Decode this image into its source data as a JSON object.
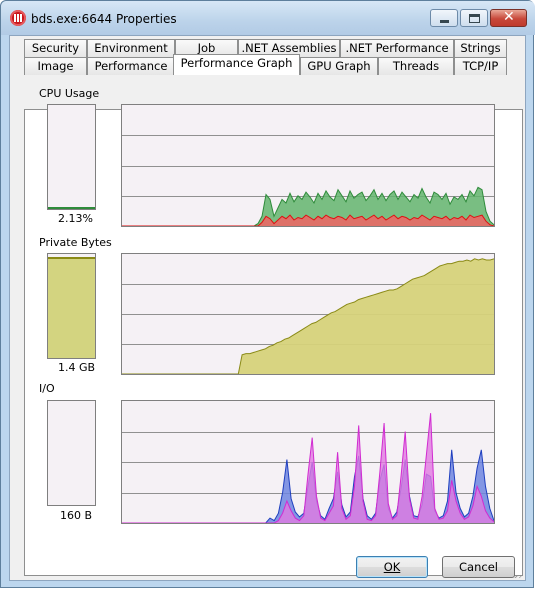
{
  "window": {
    "title": "bds.exe:6644 Properties",
    "icon": "process-app-icon"
  },
  "tabs_top": [
    "Security",
    "Environment",
    "Job",
    ".NET Assemblies",
    ".NET Performance",
    "Strings"
  ],
  "tabs_bottom": [
    "Image",
    "Performance",
    "Performance Graph",
    "GPU Graph",
    "Threads",
    "TCP/IP"
  ],
  "active_tab": "Performance Graph",
  "sections": {
    "cpu": {
      "label": "CPU Usage",
      "value": "2.13%",
      "fill_fraction": 0.02,
      "color": "#2e8b3a"
    },
    "private": {
      "label": "Private Bytes",
      "value": "1.4 GB",
      "fill_fraction": 0.95,
      "color": "#d3d480"
    },
    "io": {
      "label": "I/O",
      "value": "160 B",
      "fill_fraction": 0.0
    }
  },
  "graph_data": {
    "cpu_total": [
      0,
      0,
      0,
      0,
      0,
      0,
      0,
      0,
      0,
      0,
      0,
      0,
      0,
      0,
      0,
      0,
      0,
      0,
      0,
      0,
      0,
      0,
      0,
      0,
      0,
      0,
      0,
      0,
      0,
      0,
      0,
      0,
      0,
      0,
      2,
      8,
      26,
      22,
      8,
      15,
      22,
      19,
      27,
      20,
      25,
      22,
      28,
      24,
      19,
      27,
      22,
      29,
      24,
      21,
      30,
      25,
      20,
      29,
      23,
      26,
      28,
      21,
      25,
      30,
      22,
      27,
      21,
      26,
      29,
      22,
      28,
      24,
      20,
      26,
      23,
      31,
      24,
      19,
      28,
      26,
      22,
      27,
      18,
      24,
      22,
      26,
      20,
      29,
      25,
      32,
      30,
      12,
      4,
      1
    ],
    "cpu_kernel": [
      0,
      0,
      0,
      0,
      0,
      0,
      0,
      0,
      0,
      0,
      0,
      0,
      0,
      0,
      0,
      0,
      0,
      0,
      0,
      0,
      0,
      0,
      0,
      0,
      0,
      0,
      0,
      0,
      0,
      0,
      0,
      0,
      0,
      0,
      0,
      3,
      8,
      6,
      2,
      5,
      8,
      6,
      9,
      5,
      7,
      6,
      9,
      7,
      5,
      8,
      6,
      9,
      7,
      6,
      8,
      7,
      5,
      9,
      6,
      7,
      8,
      5,
      7,
      9,
      6,
      8,
      5,
      7,
      9,
      6,
      8,
      7,
      5,
      7,
      6,
      9,
      7,
      5,
      8,
      7,
      6,
      8,
      5,
      7,
      6,
      8,
      5,
      9,
      7,
      8,
      9,
      4,
      1,
      0
    ],
    "private_bytes": [
      0,
      0,
      0,
      0,
      0,
      0,
      0,
      0,
      0,
      0,
      0,
      0,
      0,
      0,
      0,
      0,
      0,
      0,
      0,
      0,
      0,
      0,
      0,
      0,
      0,
      0,
      0,
      0,
      0,
      0,
      0,
      16,
      17,
      17,
      18,
      19,
      20,
      21,
      23,
      24,
      26,
      27,
      29,
      30,
      32,
      34,
      36,
      38,
      40,
      42,
      43,
      45,
      47,
      49,
      51,
      52,
      54,
      56,
      58,
      59,
      60,
      62,
      63,
      64,
      65,
      66,
      67,
      68,
      69,
      70,
      70,
      71,
      73,
      75,
      77,
      79,
      80,
      81,
      82,
      84,
      86,
      88,
      90,
      91,
      92,
      92,
      93,
      94,
      94,
      95,
      94,
      96,
      95,
      96,
      95,
      95,
      96
    ],
    "io_read": [
      0,
      0,
      0,
      0,
      0,
      0,
      0,
      0,
      0,
      0,
      0,
      0,
      0,
      0,
      0,
      0,
      0,
      0,
      0,
      0,
      0,
      0,
      0,
      0,
      0,
      0,
      0,
      0,
      0,
      0,
      0,
      0,
      0,
      0,
      0,
      4,
      2,
      8,
      25,
      52,
      20,
      9,
      5,
      8,
      30,
      50,
      18,
      6,
      3,
      12,
      20,
      42,
      15,
      5,
      9,
      38,
      55,
      20,
      6,
      3,
      8,
      35,
      48,
      12,
      4,
      9,
      28,
      52,
      22,
      6,
      5,
      15,
      40,
      38,
      10,
      4,
      6,
      18,
      60,
      25,
      12,
      5,
      8,
      22,
      45,
      60,
      30,
      12,
      2
    ],
    "io_write": [
      0,
      0,
      0,
      0,
      0,
      0,
      0,
      0,
      0,
      0,
      0,
      0,
      0,
      0,
      0,
      0,
      0,
      0,
      0,
      0,
      0,
      0,
      0,
      0,
      0,
      0,
      0,
      0,
      0,
      0,
      0,
      0,
      0,
      0,
      0,
      0,
      0,
      2,
      8,
      18,
      10,
      4,
      2,
      6,
      40,
      70,
      22,
      4,
      2,
      8,
      14,
      58,
      12,
      3,
      6,
      30,
      80,
      18,
      3,
      2,
      6,
      42,
      82,
      16,
      3,
      6,
      38,
      75,
      20,
      4,
      3,
      22,
      56,
      90,
      12,
      3,
      4,
      10,
      35,
      18,
      8,
      3,
      5,
      14,
      30,
      22,
      10,
      4,
      1
    ]
  },
  "buttons": {
    "ok": "OK",
    "cancel": "Cancel"
  },
  "colors": {
    "cpu_total": "#2e8b3a",
    "cpu_kernel": "#e01010",
    "private": "#8a8a16",
    "io_read": "#1f3fbf",
    "io_write": "#d12bd1",
    "grid": "#909090"
  }
}
